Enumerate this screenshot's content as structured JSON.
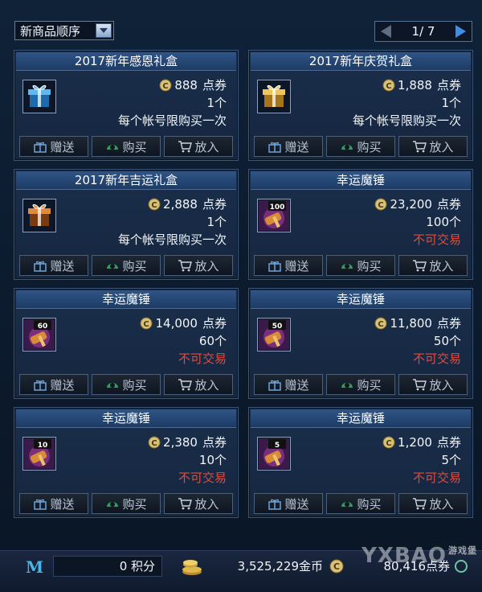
{
  "sort": {
    "label": "新商品顺序"
  },
  "pager": {
    "current": "1/ 7"
  },
  "items": [
    {
      "title": "2017新年感恩礼盒",
      "icon": "blue-gift-box-icon",
      "price": "888",
      "unit": "点券",
      "qty": "1个",
      "note": "每个帐号限购买一次",
      "note_type": "limit"
    },
    {
      "title": "2017新年庆贺礼盒",
      "icon": "gold-gift-box-icon",
      "price": "1,888",
      "unit": "点券",
      "qty": "1个",
      "note": "每个帐号限购买一次",
      "note_type": "limit"
    },
    {
      "title": "2017新年吉运礼盒",
      "icon": "orange-gift-box-icon",
      "price": "2,888",
      "unit": "点券",
      "qty": "1个",
      "note": "每个帐号限购买一次",
      "note_type": "limit"
    },
    {
      "title": "幸运魔锤",
      "icon": "lucky-hammer-icon",
      "badge": "100",
      "price": "23,200",
      "unit": "点券",
      "qty": "100个",
      "note": "不可交易",
      "note_type": "untradable"
    },
    {
      "title": "幸运魔锤",
      "icon": "lucky-hammer-icon",
      "badge": "60",
      "price": "14,000",
      "unit": "点券",
      "qty": "60个",
      "note": "不可交易",
      "note_type": "untradable"
    },
    {
      "title": "幸运魔锤",
      "icon": "lucky-hammer-icon",
      "badge": "50",
      "price": "11,800",
      "unit": "点券",
      "qty": "50个",
      "note": "不可交易",
      "note_type": "untradable"
    },
    {
      "title": "幸运魔锤",
      "icon": "lucky-hammer-icon",
      "badge": "10",
      "price": "2,380",
      "unit": "点券",
      "qty": "10个",
      "note": "不可交易",
      "note_type": "untradable"
    },
    {
      "title": "幸运魔锤",
      "icon": "lucky-hammer-icon",
      "badge": "5",
      "price": "1,200",
      "unit": "点券",
      "qty": "5个",
      "note": "不可交易",
      "note_type": "untradable"
    }
  ],
  "buttons": {
    "gift": "赠送",
    "buy": "购买",
    "cart": "放入"
  },
  "footer": {
    "points": "0 积分",
    "gold": "3,525,229金币",
    "cash": "80,416点券"
  },
  "watermark": {
    "text": "YXBAO",
    "sub": "游戏堡"
  },
  "colors": {
    "untradable": "#e64a3a",
    "accent": "#48b6e6"
  }
}
